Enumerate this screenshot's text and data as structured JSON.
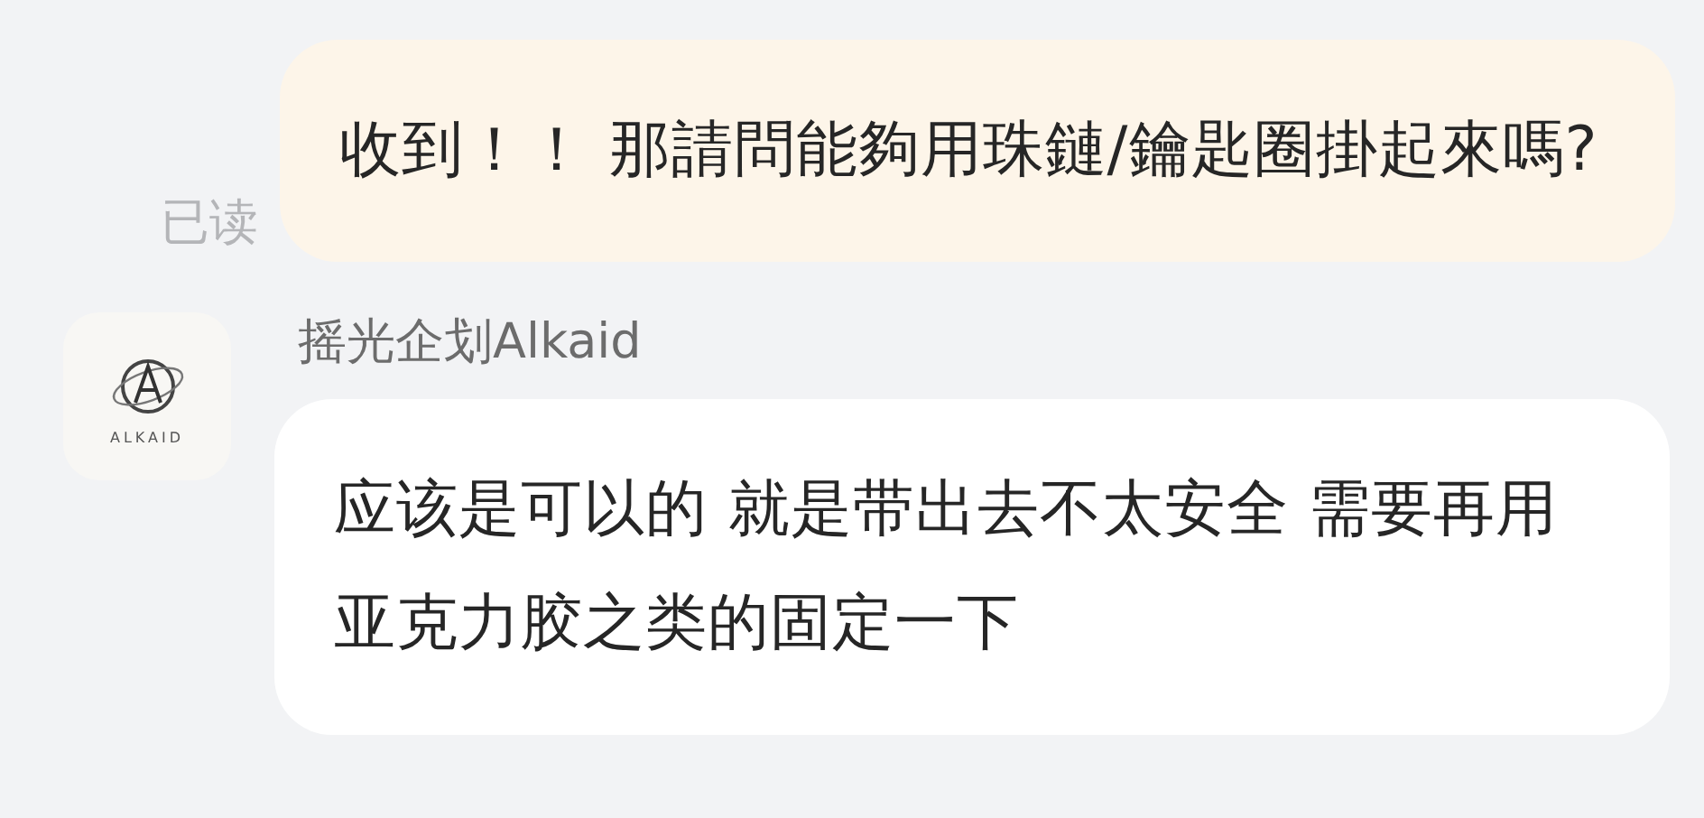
{
  "messages": [
    {
      "kind": "outgoing",
      "text": "收到！！ 那請問能夠用珠鏈/鑰匙圈掛起來嗎?",
      "receipt": "已读"
    },
    {
      "kind": "incoming",
      "sender": "摇光企划Alkaid",
      "avatar": {
        "logo_text": "ALKAID"
      },
      "text": "应该是可以的 就是带出去不太安全 需要再用亚克力胶之类的固定一下"
    }
  ]
}
